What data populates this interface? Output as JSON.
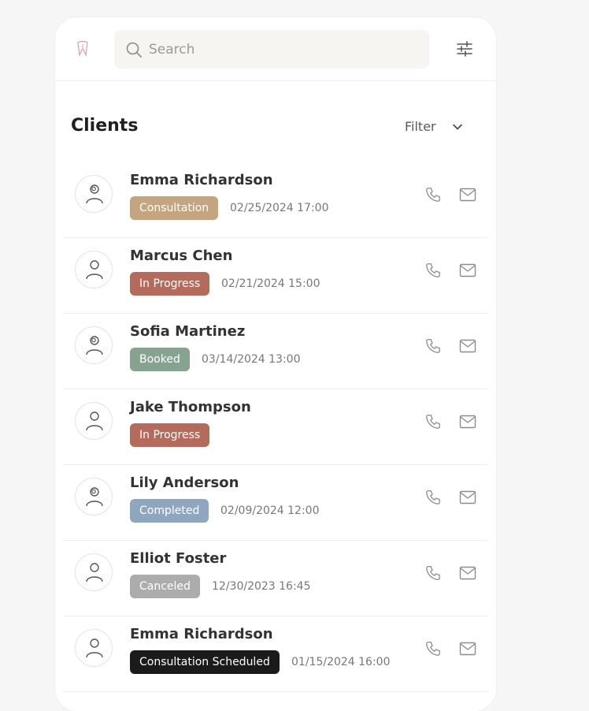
{
  "search": {
    "placeholder": "Search"
  },
  "header": {
    "title": "Clients",
    "filter_label": "Filter"
  },
  "clients": [
    {
      "name": "Emma Richardson",
      "status": "Consultation",
      "status_color": "#c4a57f",
      "date": "02/25/2024 17:00",
      "avatar": "person-with-eye-icon"
    },
    {
      "name": "Marcus Chen",
      "status": "In Progress",
      "status_color": "#b56b5c",
      "date": "02/21/2024 15:00",
      "avatar": "person-icon"
    },
    {
      "name": "Sofia Martinez",
      "status": "Booked",
      "status_color": "#86a38f",
      "date": "03/14/2024 13:00",
      "avatar": "person-with-eye-icon"
    },
    {
      "name": "Jake Thompson",
      "status": "In Progress",
      "status_color": "#b56b5c",
      "date": "",
      "avatar": "person-icon"
    },
    {
      "name": "Lily Anderson",
      "status": "Completed",
      "status_color": "#8ea6be",
      "date": "02/09/2024 12:00",
      "avatar": "person-with-eye-icon"
    },
    {
      "name": "Elliot Foster",
      "status": "Canceled",
      "status_color": "#acacac",
      "date": "12/30/2023 16:45",
      "avatar": "person-icon"
    },
    {
      "name": "Emma Richardson",
      "status": "Consultation Scheduled",
      "status_color": "#1b1b1b",
      "date": "01/15/2024 16:00",
      "avatar": "person-icon"
    }
  ],
  "colors": {
    "background": "#f6f6f6",
    "card": "#ffffff",
    "search_bg": "#f6f5f2",
    "logo_accent": "#e79aa6"
  }
}
